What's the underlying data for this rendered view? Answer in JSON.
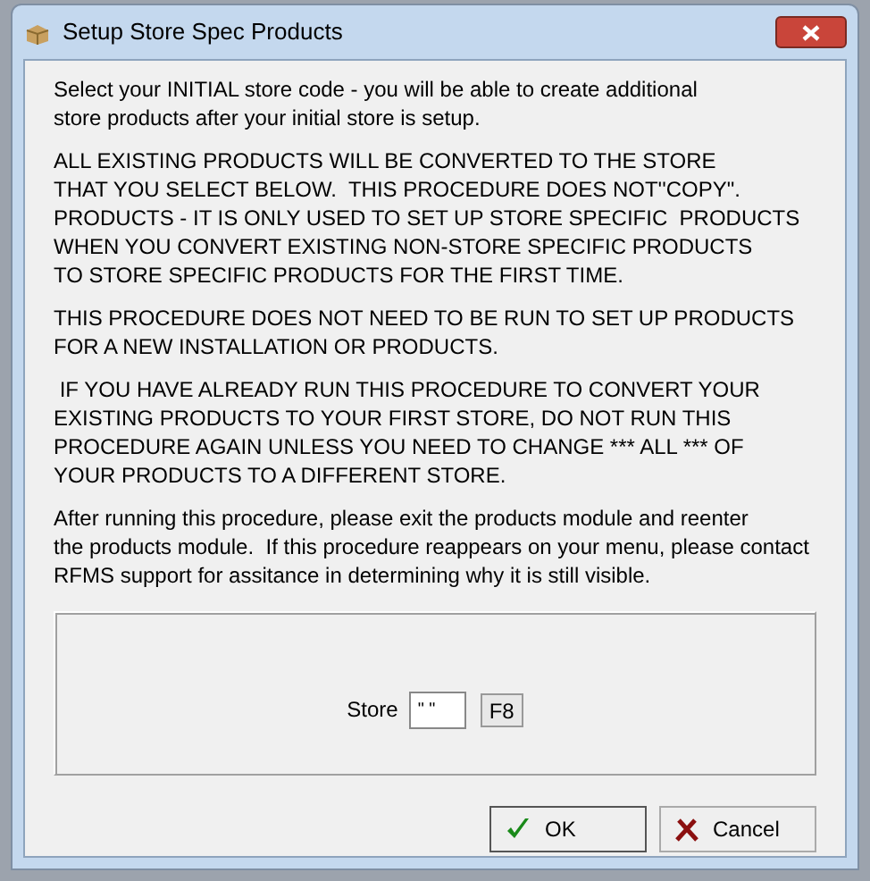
{
  "window": {
    "title": "Setup Store Spec Products"
  },
  "paragraphs": [
    {
      "lines": [
        "Select your INITIAL store code - you will be able to create additional",
        "store products after your initial store is setup."
      ]
    },
    {
      "lines": [
        "ALL EXISTING PRODUCTS WILL BE CONVERTED TO THE STORE",
        "THAT YOU SELECT BELOW.  THIS PROCEDURE DOES NOT''COPY\".",
        "PRODUCTS - IT IS ONLY USED TO SET UP STORE SPECIFIC  PRODUCTS",
        "WHEN YOU CONVERT EXISTING NON-STORE SPECIFIC PRODUCTS",
        "TO STORE SPECIFIC PRODUCTS FOR THE FIRST TIME."
      ]
    },
    {
      "lines": [
        "THIS PROCEDURE DOES NOT NEED TO BE RUN TO SET UP PRODUCTS",
        "FOR A NEW INSTALLATION OR PRODUCTS."
      ]
    },
    {
      "lines": [
        " IF YOU HAVE ALREADY RUN THIS PROCEDURE TO CONVERT YOUR",
        "EXISTING PRODUCTS TO YOUR FIRST STORE, DO NOT RUN THIS",
        "PROCEDURE AGAIN UNLESS YOU NEED TO CHANGE *** ALL *** OF",
        "YOUR PRODUCTS TO A DIFFERENT STORE."
      ]
    },
    {
      "lines": [
        "After running this procedure, please exit the products module and reenter",
        "the products module.  If this procedure reappears on your menu, please contact",
        "RFMS support for assitance in determining why it is still visible."
      ]
    }
  ],
  "store": {
    "label": "Store",
    "value": "\" \"",
    "lookup": "F8"
  },
  "buttons": [
    {
      "kind": "ok",
      "label": "OK"
    },
    {
      "kind": "cancel",
      "label": "Cancel"
    }
  ]
}
